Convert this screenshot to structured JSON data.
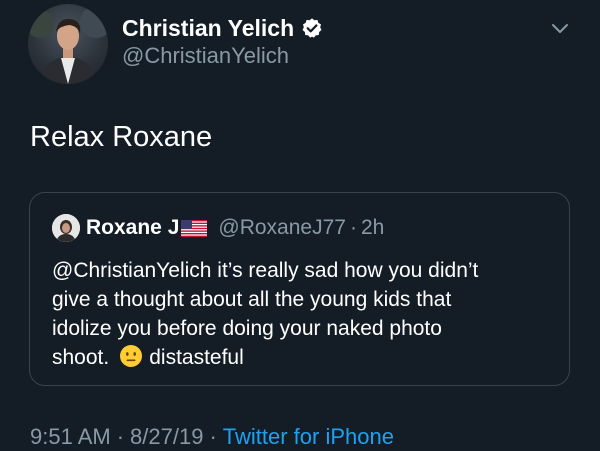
{
  "author": {
    "display_name": "Christian Yelich",
    "handle": "@ChristianYelich",
    "verified": true
  },
  "tweet": {
    "text": "Relax Roxane"
  },
  "quoted_tweet": {
    "display_name": "Roxane J",
    "flag": "us-flag-icon",
    "handle": "@RoxaneJ77",
    "separator": "·",
    "time": "2h",
    "lines": [
      "@ChristianYelich it’s really sad how you didn’t",
      "give a thought about all the young kids that",
      "idolize you before doing your naked photo"
    ],
    "last_line_start": "shoot.",
    "emoji": "neutral-face-emoji",
    "last_line_end": "distasteful"
  },
  "footer": {
    "time": "9:51 AM",
    "date": "8/27/19",
    "separator": "·",
    "source": "Twitter for iPhone"
  },
  "colors": {
    "background": "#141d26",
    "secondary_text": "#8899a6",
    "link": "#1da1f2",
    "border": "#38444d"
  }
}
